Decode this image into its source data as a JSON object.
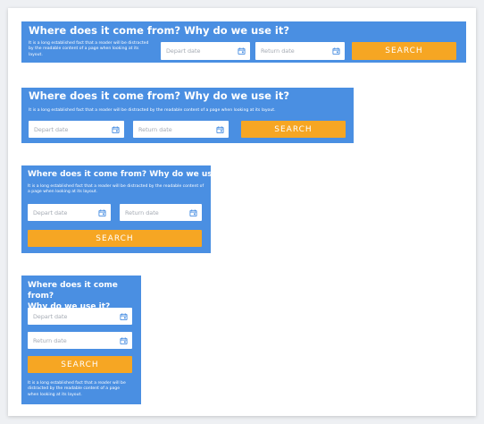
{
  "widget": {
    "title": "Where does it come from? Why do we use it?",
    "title_line1": "Where does it come from?",
    "title_line2": "Why do we use it?",
    "description": "It is a long established fact that a reader will be distracted by the readable content of a page when looking at its layout.",
    "depart_placeholder": "Depart date",
    "return_placeholder": "Return date",
    "search_label": "SEARCH",
    "calendar_icon": "calendar-icon"
  },
  "colors": {
    "panel": "#4a8fe2",
    "button": "#f6a623",
    "field": "#ffffff",
    "placeholder": "#a4aab3",
    "icon": "#4a8fe2"
  }
}
